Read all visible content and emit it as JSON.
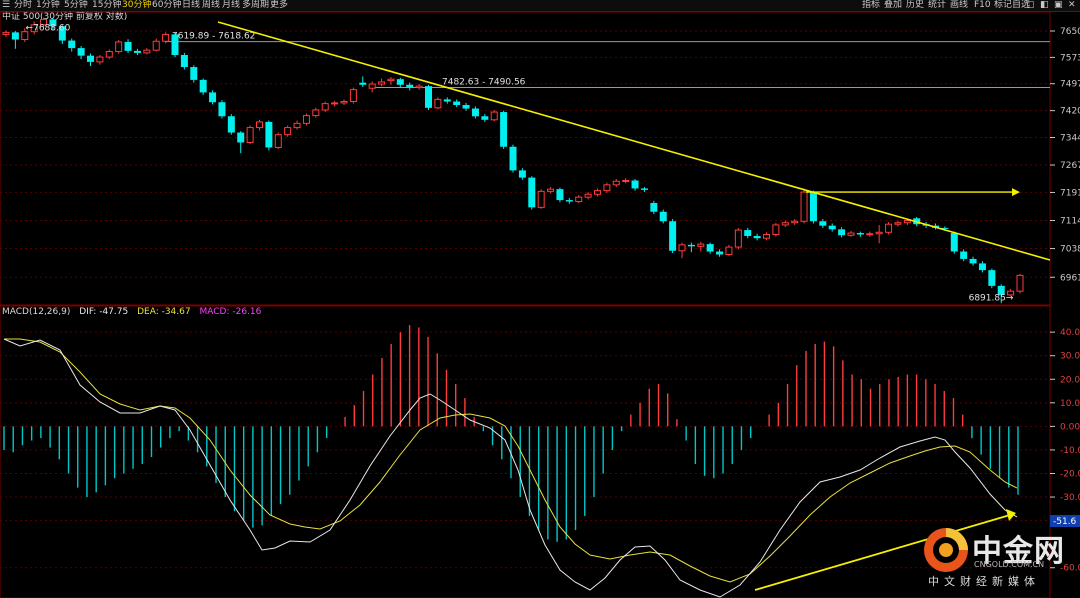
{
  "toolbar": {
    "periods": [
      "分时",
      "1分钟",
      "5分钟",
      "15分钟",
      "30分钟",
      "60分钟",
      "日线",
      "周线",
      "月线",
      "多周期",
      "更多"
    ],
    "active_period": "30分钟",
    "right_buttons": [
      "指标",
      "叠加",
      "历史",
      "统计",
      "画线",
      "F10",
      "标记",
      "自选"
    ]
  },
  "header": {
    "title": "中证 500(30分钟 前复权 对数)"
  },
  "colors": {
    "up": "#ff3b3b",
    "down": "#00f0f0",
    "dif": "#e8e8e8",
    "dea": "#e8e040",
    "trend": "#f5f000",
    "grid": "#5a0000",
    "axis_text": "#c8c8c8"
  },
  "chart_data": [
    {
      "type": "candlestick",
      "ylim": [
        6890,
        7700
      ],
      "y_ticks": [
        "7650",
        "7573",
        "7497",
        "7420",
        "7344",
        "7267",
        "7191",
        "7114",
        "7038",
        "6961"
      ],
      "annotations": {
        "high_label": "7688.60",
        "low_label": "6891.85",
        "range1": "7619.89 - 7618.62",
        "range2": "7482.63 - 7490.56"
      },
      "candles": [
        {
          "o": 7640,
          "c": 7646,
          "h": 7652,
          "l": 7632
        },
        {
          "o": 7646,
          "c": 7625,
          "h": 7650,
          "l": 7598
        },
        {
          "o": 7625,
          "c": 7648,
          "h": 7658,
          "l": 7618
        },
        {
          "o": 7648,
          "c": 7668,
          "h": 7678,
          "l": 7640
        },
        {
          "o": 7668,
          "c": 7684,
          "h": 7689,
          "l": 7660
        },
        {
          "o": 7684,
          "c": 7664,
          "h": 7689,
          "l": 7652
        },
        {
          "o": 7664,
          "c": 7622,
          "h": 7667,
          "l": 7612
        },
        {
          "o": 7622,
          "c": 7600,
          "h": 7628,
          "l": 7590
        },
        {
          "o": 7600,
          "c": 7578,
          "h": 7606,
          "l": 7568
        },
        {
          "o": 7578,
          "c": 7560,
          "h": 7584,
          "l": 7548
        },
        {
          "o": 7560,
          "c": 7574,
          "h": 7580,
          "l": 7552
        },
        {
          "o": 7574,
          "c": 7590,
          "h": 7596,
          "l": 7568
        },
        {
          "o": 7590,
          "c": 7618,
          "h": 7624,
          "l": 7584
        },
        {
          "o": 7618,
          "c": 7592,
          "h": 7626,
          "l": 7586
        },
        {
          "o": 7592,
          "c": 7586,
          "h": 7598,
          "l": 7580
        },
        {
          "o": 7586,
          "c": 7594,
          "h": 7600,
          "l": 7582
        },
        {
          "o": 7594,
          "c": 7620,
          "h": 7628,
          "l": 7590
        },
        {
          "o": 7620,
          "c": 7640,
          "h": 7646,
          "l": 7614
        },
        {
          "o": 7640,
          "c": 7580,
          "h": 7644,
          "l": 7574
        },
        {
          "o": 7580,
          "c": 7545,
          "h": 7586,
          "l": 7538
        },
        {
          "o": 7545,
          "c": 7508,
          "h": 7550,
          "l": 7500
        },
        {
          "o": 7508,
          "c": 7472,
          "h": 7512,
          "l": 7465
        },
        {
          "o": 7472,
          "c": 7444,
          "h": 7478,
          "l": 7438
        },
        {
          "o": 7444,
          "c": 7404,
          "h": 7450,
          "l": 7398
        },
        {
          "o": 7404,
          "c": 7358,
          "h": 7410,
          "l": 7352
        },
        {
          "o": 7358,
          "c": 7330,
          "h": 7362,
          "l": 7300
        },
        {
          "o": 7330,
          "c": 7372,
          "h": 7378,
          "l": 7326
        },
        {
          "o": 7372,
          "c": 7388,
          "h": 7394,
          "l": 7364
        },
        {
          "o": 7388,
          "c": 7316,
          "h": 7392,
          "l": 7308
        },
        {
          "o": 7316,
          "c": 7352,
          "h": 7358,
          "l": 7312
        },
        {
          "o": 7352,
          "c": 7372,
          "h": 7378,
          "l": 7346
        },
        {
          "o": 7372,
          "c": 7384,
          "h": 7392,
          "l": 7366
        },
        {
          "o": 7384,
          "c": 7406,
          "h": 7412,
          "l": 7378
        },
        {
          "o": 7406,
          "c": 7422,
          "h": 7428,
          "l": 7400
        },
        {
          "o": 7422,
          "c": 7440,
          "h": 7446,
          "l": 7416
        },
        {
          "o": 7440,
          "c": 7442,
          "h": 7448,
          "l": 7432
        },
        {
          "o": 7442,
          "c": 7446,
          "h": 7452,
          "l": 7436
        },
        {
          "o": 7446,
          "c": 7480,
          "h": 7486,
          "l": 7440
        },
        {
          "o": 7500,
          "c": 7494,
          "h": 7518,
          "l": 7488
        },
        {
          "o": 7484,
          "c": 7496,
          "h": 7504,
          "l": 7472
        },
        {
          "o": 7496,
          "c": 7502,
          "h": 7512,
          "l": 7490
        },
        {
          "o": 7506,
          "c": 7510,
          "h": 7516,
          "l": 7494
        },
        {
          "o": 7510,
          "c": 7494,
          "h": 7514,
          "l": 7486
        },
        {
          "o": 7494,
          "c": 7486,
          "h": 7500,
          "l": 7478
        },
        {
          "o": 7486,
          "c": 7490,
          "h": 7496,
          "l": 7480
        },
        {
          "o": 7490,
          "c": 7428,
          "h": 7494,
          "l": 7422
        },
        {
          "o": 7428,
          "c": 7452,
          "h": 7458,
          "l": 7424
        },
        {
          "o": 7452,
          "c": 7446,
          "h": 7458,
          "l": 7440
        },
        {
          "o": 7446,
          "c": 7436,
          "h": 7452,
          "l": 7430
        },
        {
          "o": 7436,
          "c": 7426,
          "h": 7442,
          "l": 7420
        },
        {
          "o": 7426,
          "c": 7404,
          "h": 7432,
          "l": 7398
        },
        {
          "o": 7404,
          "c": 7394,
          "h": 7410,
          "l": 7388
        },
        {
          "o": 7394,
          "c": 7416,
          "h": 7422,
          "l": 7390
        },
        {
          "o": 7416,
          "c": 7318,
          "h": 7420,
          "l": 7312
        },
        {
          "o": 7318,
          "c": 7252,
          "h": 7324,
          "l": 7246
        },
        {
          "o": 7252,
          "c": 7232,
          "h": 7258,
          "l": 7226
        },
        {
          "o": 7232,
          "c": 7150,
          "h": 7236,
          "l": 7144
        },
        {
          "o": 7150,
          "c": 7194,
          "h": 7200,
          "l": 7146
        },
        {
          "o": 7194,
          "c": 7200,
          "h": 7206,
          "l": 7188
        },
        {
          "o": 7200,
          "c": 7170,
          "h": 7204,
          "l": 7164
        },
        {
          "o": 7170,
          "c": 7166,
          "h": 7176,
          "l": 7160
        },
        {
          "o": 7166,
          "c": 7178,
          "h": 7184,
          "l": 7162
        },
        {
          "o": 7178,
          "c": 7186,
          "h": 7192,
          "l": 7172
        },
        {
          "o": 7186,
          "c": 7196,
          "h": 7202,
          "l": 7180
        },
        {
          "o": 7196,
          "c": 7212,
          "h": 7218,
          "l": 7190
        },
        {
          "o": 7212,
          "c": 7222,
          "h": 7228,
          "l": 7206
        },
        {
          "o": 7222,
          "c": 7224,
          "h": 7230,
          "l": 7216
        },
        {
          "o": 7224,
          "c": 7202,
          "h": 7228,
          "l": 7196
        },
        {
          "o": 7202,
          "c": 7198,
          "h": 7206,
          "l": 7192
        },
        {
          "o": 7162,
          "c": 7138,
          "h": 7168,
          "l": 7132
        },
        {
          "o": 7138,
          "c": 7112,
          "h": 7144,
          "l": 7106
        },
        {
          "o": 7112,
          "c": 7032,
          "h": 7118,
          "l": 7026
        },
        {
          "o": 7032,
          "c": 7048,
          "h": 7054,
          "l": 7012
        },
        {
          "o": 7048,
          "c": 7044,
          "h": 7054,
          "l": 7028
        },
        {
          "o": 7044,
          "c": 7050,
          "h": 7056,
          "l": 7030
        },
        {
          "o": 7050,
          "c": 7030,
          "h": 7054,
          "l": 7024
        },
        {
          "o": 7030,
          "c": 7022,
          "h": 7036,
          "l": 7016
        },
        {
          "o": 7022,
          "c": 7042,
          "h": 7048,
          "l": 7018
        },
        {
          "o": 7042,
          "c": 7088,
          "h": 7094,
          "l": 7036
        },
        {
          "o": 7088,
          "c": 7072,
          "h": 7094,
          "l": 7066
        },
        {
          "o": 7072,
          "c": 7066,
          "h": 7078,
          "l": 7060
        },
        {
          "o": 7066,
          "c": 7076,
          "h": 7082,
          "l": 7060
        },
        {
          "o": 7076,
          "c": 7102,
          "h": 7108,
          "l": 7070
        },
        {
          "o": 7102,
          "c": 7108,
          "h": 7114,
          "l": 7096
        },
        {
          "o": 7108,
          "c": 7112,
          "h": 7118,
          "l": 7102
        },
        {
          "o": 7112,
          "c": 7192,
          "h": 7198,
          "l": 7106
        },
        {
          "o": 7192,
          "c": 7112,
          "h": 7196,
          "l": 7106
        },
        {
          "o": 7112,
          "c": 7100,
          "h": 7118,
          "l": 7094
        },
        {
          "o": 7100,
          "c": 7090,
          "h": 7106,
          "l": 7084
        },
        {
          "o": 7090,
          "c": 7074,
          "h": 7096,
          "l": 7068
        },
        {
          "o": 7074,
          "c": 7080,
          "h": 7086,
          "l": 7070
        },
        {
          "o": 7080,
          "c": 7076,
          "h": 7084,
          "l": 7070
        },
        {
          "o": 7076,
          "c": 7078,
          "h": 7084,
          "l": 7070
        },
        {
          "o": 7078,
          "c": 7082,
          "h": 7102,
          "l": 7052
        },
        {
          "o": 7082,
          "c": 7104,
          "h": 7110,
          "l": 7076
        },
        {
          "o": 7104,
          "c": 7108,
          "h": 7114,
          "l": 7098
        },
        {
          "o": 7108,
          "c": 7114,
          "h": 7120,
          "l": 7102
        },
        {
          "o": 7120,
          "c": 7104,
          "h": 7124,
          "l": 7098
        },
        {
          "o": 7104,
          "c": 7100,
          "h": 7110,
          "l": 7094
        },
        {
          "o": 7100,
          "c": 7094,
          "h": 7106,
          "l": 7090
        },
        {
          "o": 7094,
          "c": 7092,
          "h": 7098,
          "l": 7086
        },
        {
          "o": 7080,
          "c": 7030,
          "h": 7084,
          "l": 7024
        },
        {
          "o": 7030,
          "c": 7010,
          "h": 7036,
          "l": 7004
        },
        {
          "o": 7010,
          "c": 6998,
          "h": 7016,
          "l": 6992
        },
        {
          "o": 6998,
          "c": 6980,
          "h": 7004,
          "l": 6974
        },
        {
          "o": 6980,
          "c": 6938,
          "h": 6984,
          "l": 6932
        },
        {
          "o": 6938,
          "c": 6914,
          "h": 6942,
          "l": 6892
        },
        {
          "o": 6914,
          "c": 6924,
          "h": 6930,
          "l": 6910
        },
        {
          "o": 6924,
          "c": 6966,
          "h": 6970,
          "l": 6918
        }
      ]
    },
    {
      "type": "macd",
      "params": "MACD(12,26,9)",
      "dif_label": "DIF: -47.75",
      "dea_label": "DEA: -34.67",
      "macd_label": "MACD: -26.16",
      "current_value": "-51.6",
      "ylim": [
        -72,
        46
      ],
      "y_ticks": [
        "40.00",
        "30.00",
        "20.00",
        "10.00",
        "0.00",
        "-10.00",
        "-20.00",
        "-30.00",
        "-40.00",
        "-60.00"
      ],
      "macd_hist": [
        -10,
        -11,
        -8,
        -6,
        -5,
        -9,
        -14,
        -20,
        -26,
        -30,
        -28,
        -25,
        -22,
        -20,
        -18,
        -16,
        -13,
        -9,
        -5,
        -2,
        -6,
        -11,
        -17,
        -24,
        -30,
        -36,
        -40,
        -43,
        -42,
        -38,
        -33,
        -29,
        -23,
        -17,
        -11,
        -5,
        0,
        4,
        9,
        15,
        22,
        29,
        35,
        40,
        43,
        42,
        38,
        31,
        24,
        18,
        12,
        4,
        -2,
        -8,
        -14,
        -22,
        -30,
        -38,
        -44,
        -48,
        -49,
        -48,
        -44,
        -38,
        -30,
        -20,
        -10,
        -2,
        5,
        10,
        16,
        18,
        14,
        3,
        -6,
        -16,
        -21,
        -22,
        -20,
        -16,
        -10,
        -5,
        0,
        5,
        10,
        18,
        26,
        32,
        35,
        36,
        34,
        28,
        22,
        20,
        16,
        18,
        20,
        21,
        22,
        22,
        20,
        18,
        15,
        12,
        5,
        -5,
        -12,
        -18,
        -22,
        -26,
        -29
      ]
    }
  ]
}
